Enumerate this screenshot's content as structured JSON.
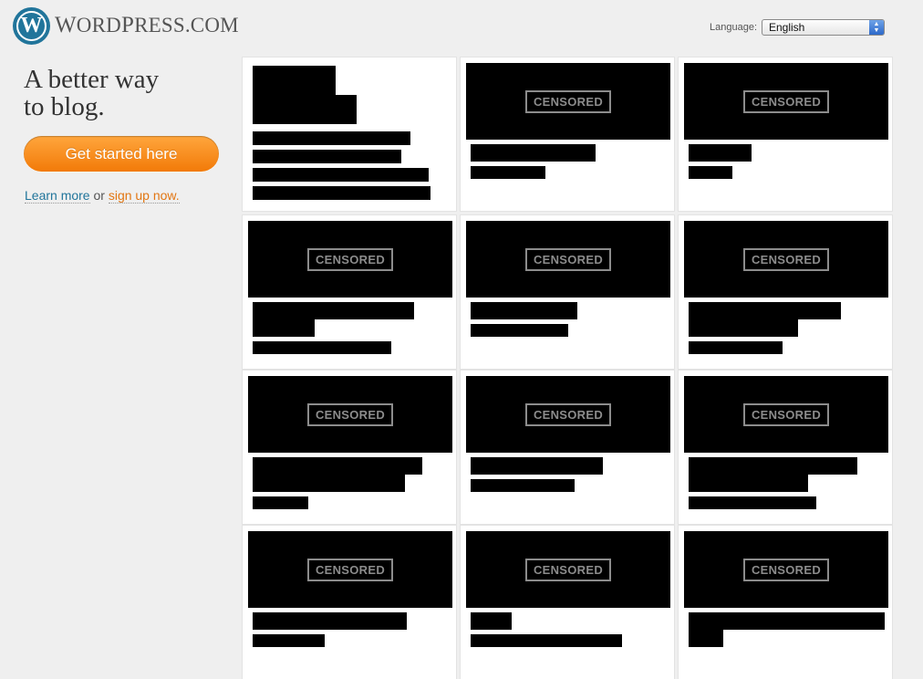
{
  "header": {
    "logo_letter": "W",
    "logo_text_w": "W",
    "logo_text_ord": "ORD",
    "logo_text_p": "P",
    "logo_text_ress": "RESS",
    "logo_text_com": ".COM",
    "language_label": "Language:",
    "language_value": "English"
  },
  "hero": {
    "tagline_line1": "A better way",
    "tagline_line2": "to blog.",
    "cta_label": "Get started here",
    "learn_more": "Learn more",
    "or_text": " or ",
    "sign_up": "sign up now."
  },
  "grid": {
    "placeholder_label": "CENSORED",
    "cards": [
      {
        "thumb": false
      },
      {
        "thumb": true
      },
      {
        "thumb": true
      },
      {
        "thumb": true
      },
      {
        "thumb": true
      },
      {
        "thumb": true
      },
      {
        "thumb": true
      },
      {
        "thumb": true
      },
      {
        "thumb": true
      },
      {
        "thumb": true
      },
      {
        "thumb": true
      },
      {
        "thumb": true
      }
    ]
  },
  "colors": {
    "brand_blue": "#21759b",
    "cta_orange": "#f27a08",
    "signup_orange": "#e27613"
  }
}
